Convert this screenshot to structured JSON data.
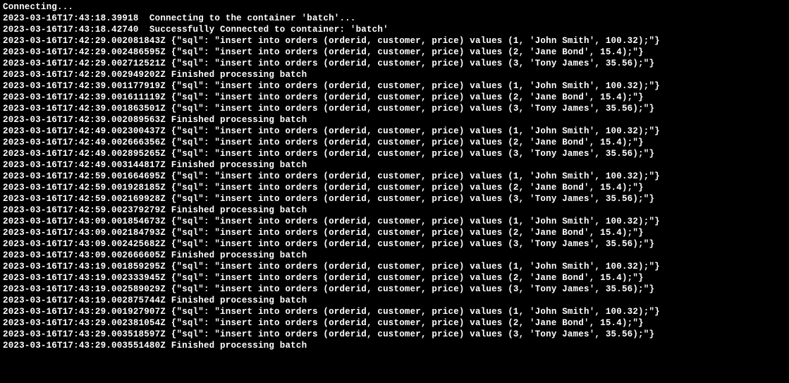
{
  "terminal": {
    "lines": [
      "Connecting...",
      "2023-03-16T17:43:18.39918  Connecting to the container 'batch'...",
      "2023-03-16T17:43:18.42740  Successfully Connected to container: 'batch'",
      "2023-03-16T17:42:29.002081843Z {\"sql\": \"insert into orders (orderid, customer, price) values (1, 'John Smith', 100.32);\"}",
      "2023-03-16T17:42:29.002486595Z {\"sql\": \"insert into orders (orderid, customer, price) values (2, 'Jane Bond', 15.4);\"}",
      "2023-03-16T17:42:29.002712521Z {\"sql\": \"insert into orders (orderid, customer, price) values (3, 'Tony James', 35.56);\"}",
      "2023-03-16T17:42:29.002949202Z Finished processing batch",
      "2023-03-16T17:42:39.001177919Z {\"sql\": \"insert into orders (orderid, customer, price) values (1, 'John Smith', 100.32);\"}",
      "2023-03-16T17:42:39.001611119Z {\"sql\": \"insert into orders (orderid, customer, price) values (2, 'Jane Bond', 15.4);\"}",
      "2023-03-16T17:42:39.001863501Z {\"sql\": \"insert into orders (orderid, customer, price) values (3, 'Tony James', 35.56);\"}",
      "2023-03-16T17:42:39.002089563Z Finished processing batch",
      "2023-03-16T17:42:49.002300437Z {\"sql\": \"insert into orders (orderid, customer, price) values (1, 'John Smith', 100.32);\"}",
      "2023-03-16T17:42:49.002666356Z {\"sql\": \"insert into orders (orderid, customer, price) values (2, 'Jane Bond', 15.4);\"}",
      "2023-03-16T17:42:49.002895265Z {\"sql\": \"insert into orders (orderid, customer, price) values (3, 'Tony James', 35.56);\"}",
      "2023-03-16T17:42:49.003144817Z Finished processing batch",
      "2023-03-16T17:42:59.001664695Z {\"sql\": \"insert into orders (orderid, customer, price) values (1, 'John Smith', 100.32);\"}",
      "2023-03-16T17:42:59.001928185Z {\"sql\": \"insert into orders (orderid, customer, price) values (2, 'Jane Bond', 15.4);\"}",
      "2023-03-16T17:42:59.002169928Z {\"sql\": \"insert into orders (orderid, customer, price) values (3, 'Tony James', 35.56);\"}",
      "2023-03-16T17:42:59.002379279Z Finished processing batch",
      "2023-03-16T17:43:09.001854673Z {\"sql\": \"insert into orders (orderid, customer, price) values (1, 'John Smith', 100.32);\"}",
      "2023-03-16T17:43:09.002184793Z {\"sql\": \"insert into orders (orderid, customer, price) values (2, 'Jane Bond', 15.4);\"}",
      "2023-03-16T17:43:09.002425682Z {\"sql\": \"insert into orders (orderid, customer, price) values (3, 'Tony James', 35.56);\"}",
      "2023-03-16T17:43:09.002666605Z Finished processing batch",
      "2023-03-16T17:43:19.001859295Z {\"sql\": \"insert into orders (orderid, customer, price) values (1, 'John Smith', 100.32);\"}",
      "2023-03-16T17:43:19.002333945Z {\"sql\": \"insert into orders (orderid, customer, price) values (2, 'Jane Bond', 15.4);\"}",
      "2023-03-16T17:43:19.002589029Z {\"sql\": \"insert into orders (orderid, customer, price) values (3, 'Tony James', 35.56);\"}",
      "2023-03-16T17:43:19.002875744Z Finished processing batch",
      "2023-03-16T17:43:29.001927907Z {\"sql\": \"insert into orders (orderid, customer, price) values (1, 'John Smith', 100.32);\"}",
      "2023-03-16T17:43:29.002381054Z {\"sql\": \"insert into orders (orderid, customer, price) values (2, 'Jane Bond', 15.4);\"}",
      "2023-03-16T17:43:29.003518597Z {\"sql\": \"insert into orders (orderid, customer, price) values (3, 'Tony James', 35.56);\"}",
      "2023-03-16T17:43:29.003551480Z Finished processing batch"
    ]
  }
}
